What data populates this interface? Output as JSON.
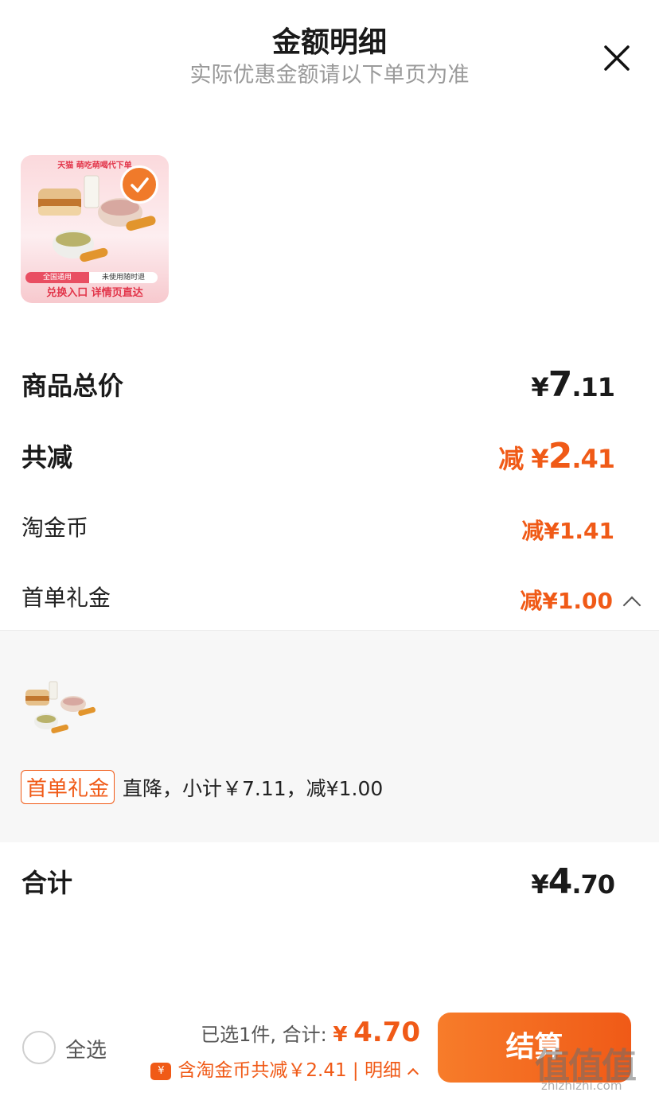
{
  "header": {
    "title": "金额明细",
    "subtitle": "实际优惠金额请以下单页为准",
    "close_icon": "close-icon"
  },
  "product": {
    "brand_line": "天猫 萌吃萌喝代下单",
    "tag_left": "全国通用",
    "tag_right": "未使用随时退",
    "footer": "兑换入口 详情页直达",
    "selected": true
  },
  "price_rows": {
    "total_label": "商品总价",
    "total_currency": "¥",
    "total_int": "7",
    "total_dec": ".11",
    "discount_label": "共减",
    "discount_prefix": "减 ¥",
    "discount_int": "2",
    "discount_dec": ".41",
    "coin_label": "淘金币",
    "coin_value": "减¥1.41",
    "gift_label": "首单礼金",
    "gift_value": "减¥1.00"
  },
  "detail": {
    "tag": "首单礼金",
    "text": "直降，小计￥7.11，减¥1.00"
  },
  "grand_total": {
    "label": "合计",
    "currency": "¥",
    "int": "4",
    "dec": ".70"
  },
  "bottom_bar": {
    "select_all": "全选",
    "selected_text": "已选1件, 合计:",
    "yen": "¥",
    "total": "4.70",
    "coin_icon_text": "¥",
    "savings_text": "含淘金币共减￥2.41 | 明细",
    "checkout_label": "结算"
  },
  "watermark": {
    "main": "值值值",
    "sub": "zhizhizhi.com"
  },
  "colors": {
    "accent": "#f05a17",
    "card_pink": "#fbd9dc"
  }
}
